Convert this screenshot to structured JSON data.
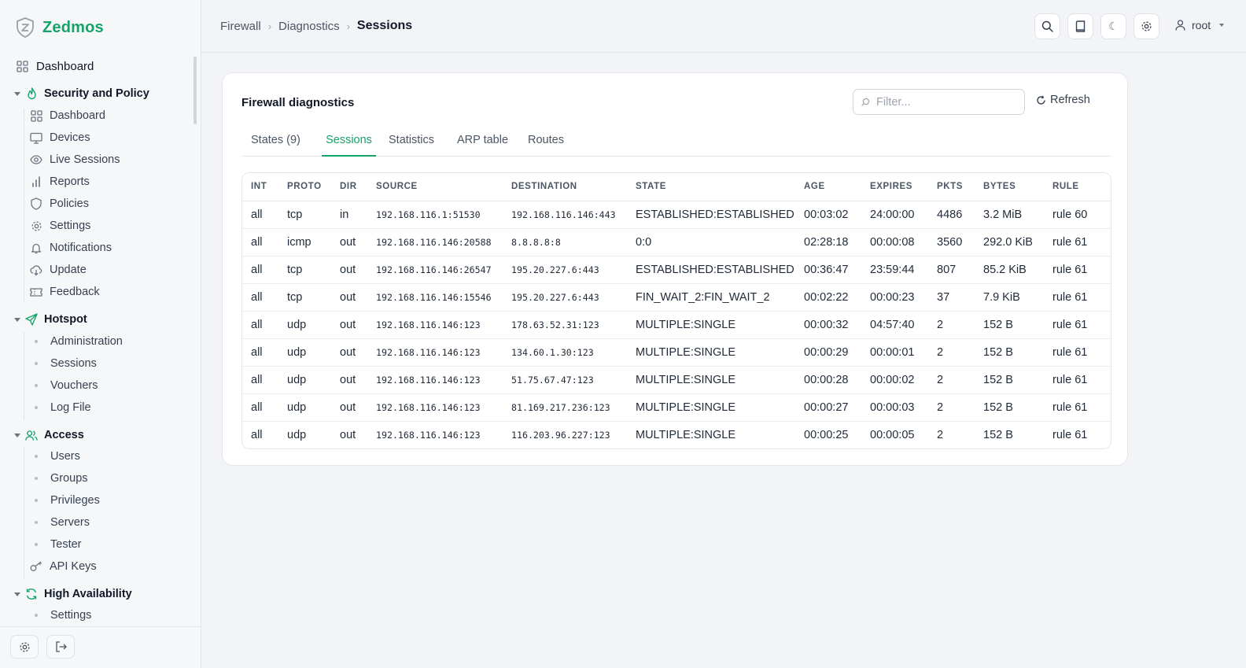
{
  "brand": {
    "name": "Zedmos"
  },
  "sidebar": {
    "top_item": {
      "label": "Dashboard",
      "icon": "dashboard-icon"
    },
    "groups": [
      {
        "label": "Security and Policy",
        "icon": "flame-icon",
        "items": [
          {
            "label": "Dashboard",
            "icon": "dashboard-icon"
          },
          {
            "label": "Devices",
            "icon": "monitor-icon"
          },
          {
            "label": "Live Sessions",
            "icon": "eye-icon"
          },
          {
            "label": "Reports",
            "icon": "bar-chart-icon"
          },
          {
            "label": "Policies",
            "icon": "shield-icon"
          },
          {
            "label": "Settings",
            "icon": "gear-icon"
          },
          {
            "label": "Notifications",
            "icon": "bell-icon"
          },
          {
            "label": "Update",
            "icon": "cloud-download-icon"
          },
          {
            "label": "Feedback",
            "icon": "ticket-icon"
          }
        ]
      },
      {
        "label": "Hotspot",
        "icon": "send-icon",
        "items": [
          {
            "label": "Administration"
          },
          {
            "label": "Sessions"
          },
          {
            "label": "Vouchers"
          },
          {
            "label": "Log File"
          }
        ]
      },
      {
        "label": "Access",
        "icon": "users-icon",
        "items": [
          {
            "label": "Users"
          },
          {
            "label": "Groups"
          },
          {
            "label": "Privileges"
          },
          {
            "label": "Servers"
          },
          {
            "label": "Tester"
          },
          {
            "label": "API Keys",
            "icon": "key-icon"
          }
        ]
      },
      {
        "label": "High Availability",
        "icon": "refresh-icon",
        "items": [
          {
            "label": "Settings"
          }
        ]
      }
    ]
  },
  "breadcrumb": [
    "Firewall",
    "Diagnostics",
    "Sessions"
  ],
  "topbar": {
    "user": "root"
  },
  "card": {
    "title": "Firewall diagnostics",
    "filter_placeholder": "Filter...",
    "refresh_label": "Refresh",
    "tabs": [
      "States (9)",
      "Sessions",
      "Statistics",
      "ARP table",
      "Routes"
    ],
    "active_tab": "Sessions"
  },
  "table": {
    "columns": [
      "INT",
      "PROTO",
      "DIR",
      "SOURCE",
      "DESTINATION",
      "STATE",
      "AGE",
      "EXPIRES",
      "PKTS",
      "BYTES",
      "RULE"
    ],
    "rows": [
      [
        "all",
        "tcp",
        "in",
        "192.168.116.1:51530",
        "192.168.116.146:443",
        "ESTABLISHED:ESTABLISHED",
        "00:03:02",
        "24:00:00",
        "4486",
        "3.2 MiB",
        "rule 60"
      ],
      [
        "all",
        "icmp",
        "out",
        "192.168.116.146:20588",
        "8.8.8.8:8",
        "0:0",
        "02:28:18",
        "00:00:08",
        "3560",
        "292.0 KiB",
        "rule 61"
      ],
      [
        "all",
        "tcp",
        "out",
        "192.168.116.146:26547",
        "195.20.227.6:443",
        "ESTABLISHED:ESTABLISHED",
        "00:36:47",
        "23:59:44",
        "807",
        "85.2 KiB",
        "rule 61"
      ],
      [
        "all",
        "tcp",
        "out",
        "192.168.116.146:15546",
        "195.20.227.6:443",
        "FIN_WAIT_2:FIN_WAIT_2",
        "00:02:22",
        "00:00:23",
        "37",
        "7.9 KiB",
        "rule 61"
      ],
      [
        "all",
        "udp",
        "out",
        "192.168.116.146:123",
        "178.63.52.31:123",
        "MULTIPLE:SINGLE",
        "00:00:32",
        "04:57:40",
        "2",
        "152 B",
        "rule 61"
      ],
      [
        "all",
        "udp",
        "out",
        "192.168.116.146:123",
        "134.60.1.30:123",
        "MULTIPLE:SINGLE",
        "00:00:29",
        "00:00:01",
        "2",
        "152 B",
        "rule 61"
      ],
      [
        "all",
        "udp",
        "out",
        "192.168.116.146:123",
        "51.75.67.47:123",
        "MULTIPLE:SINGLE",
        "00:00:28",
        "00:00:02",
        "2",
        "152 B",
        "rule 61"
      ],
      [
        "all",
        "udp",
        "out",
        "192.168.116.146:123",
        "81.169.217.236:123",
        "MULTIPLE:SINGLE",
        "00:00:27",
        "00:00:03",
        "2",
        "152 B",
        "rule 61"
      ],
      [
        "all",
        "udp",
        "out",
        "192.168.116.146:123",
        "116.203.96.227:123",
        "MULTIPLE:SINGLE",
        "00:00:25",
        "00:00:05",
        "2",
        "152 B",
        "rule 61"
      ]
    ]
  },
  "colors": {
    "accent": "#16a36a",
    "text": "#1f2937",
    "muted": "#6b7280",
    "border": "#e5e7eb"
  }
}
